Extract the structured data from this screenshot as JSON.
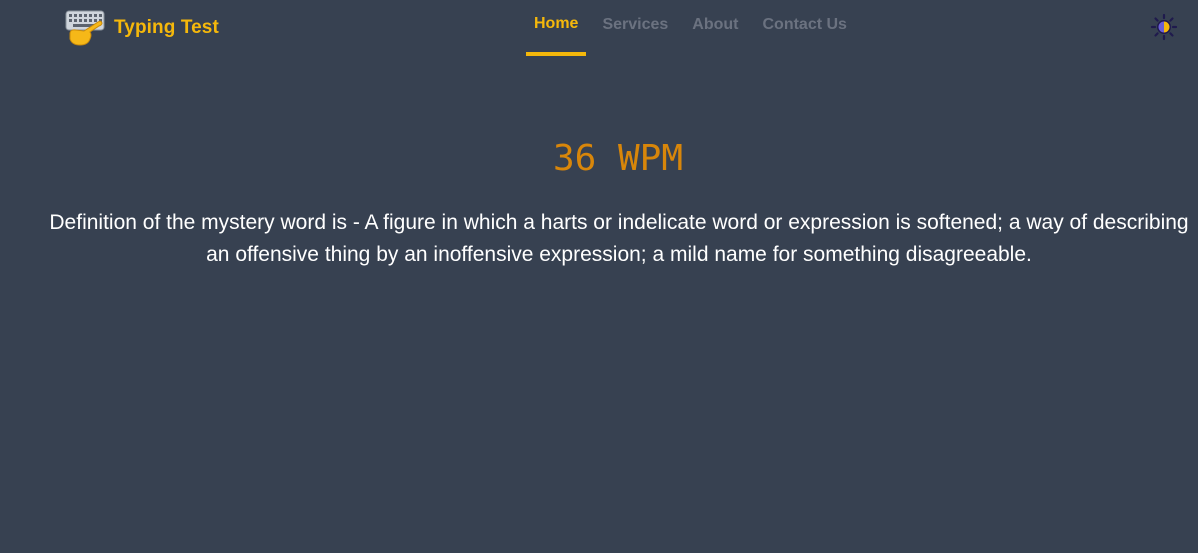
{
  "brand": {
    "title": "Typing Test",
    "logo_icon": "keyboard-with-pointing-hand-icon"
  },
  "nav": {
    "items": [
      {
        "label": "Home",
        "active": true
      },
      {
        "label": "Services",
        "active": false
      },
      {
        "label": "About",
        "active": false
      },
      {
        "label": "Contact Us",
        "active": false
      }
    ]
  },
  "theme_toggle": {
    "icon": "sun-half-moon-icon"
  },
  "result": {
    "wpm": "36 WPM",
    "definition": "Definition of the mystery word is - A figure in which a harts or indelicate word or expression is softened; a way of describing an offensive thing by an inoffensive expression; a mild name for something disagreeable."
  },
  "colors": {
    "background": "#374151",
    "accent": "#f5b80b",
    "wpm": "#d8860a",
    "nav_inactive": "#6b7280",
    "text": "#ffffff"
  }
}
